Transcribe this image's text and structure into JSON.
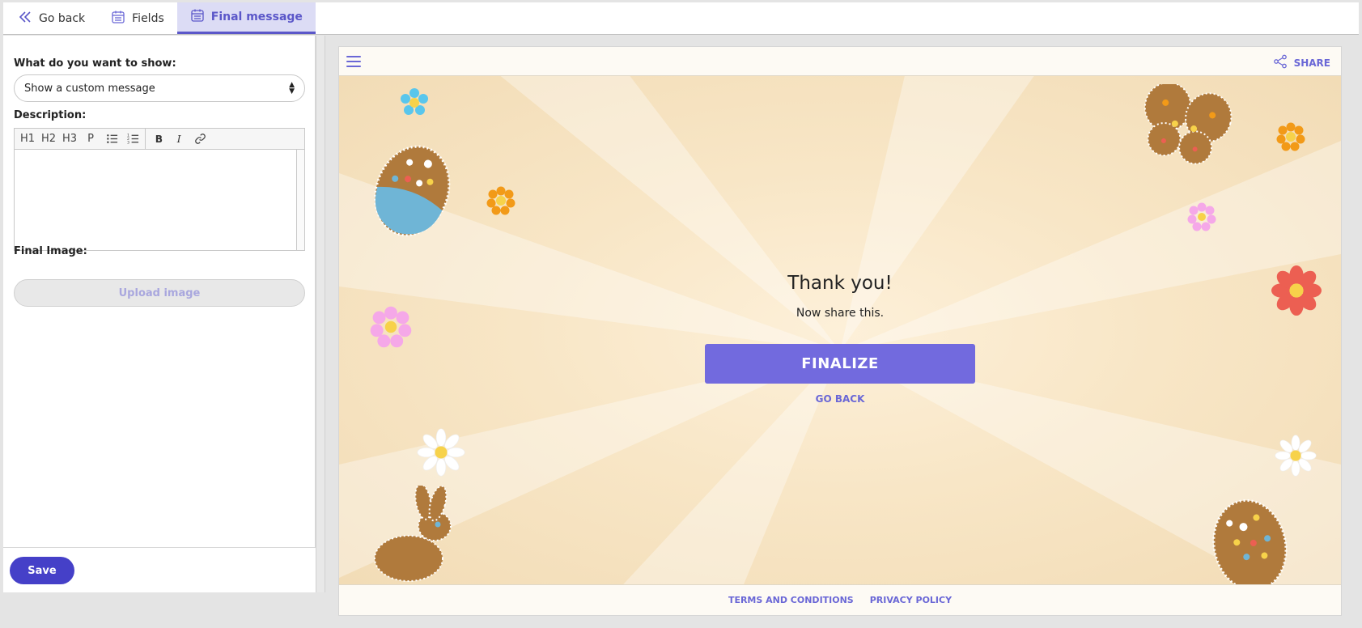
{
  "tabs": [
    {
      "label": "Go back",
      "icon": "chevrons-left-icon"
    },
    {
      "label": "Fields",
      "icon": "calendar-icon"
    },
    {
      "label": "Final message",
      "icon": "calendar-icon",
      "active": true
    }
  ],
  "left": {
    "show_label": "What do you want to show:",
    "show_value": "Show a custom message",
    "description_label": "Description:",
    "toolbar": [
      "H1",
      "H2",
      "H3",
      "P"
    ],
    "final_image_label": "Final Image:",
    "upload_label": "Upload image",
    "save_label": "Save"
  },
  "preview": {
    "share_label": "SHARE",
    "title": "Thank you!",
    "subtitle": "Now share this.",
    "finalize_label": "FINALIZE",
    "goback_label": "GO BACK",
    "footer_links": [
      "TERMS AND CONDITIONS",
      "PRIVACY POLICY"
    ]
  },
  "colors": {
    "accent": "#726ade",
    "save": "#4540c8",
    "background": "#f2e3c6"
  }
}
